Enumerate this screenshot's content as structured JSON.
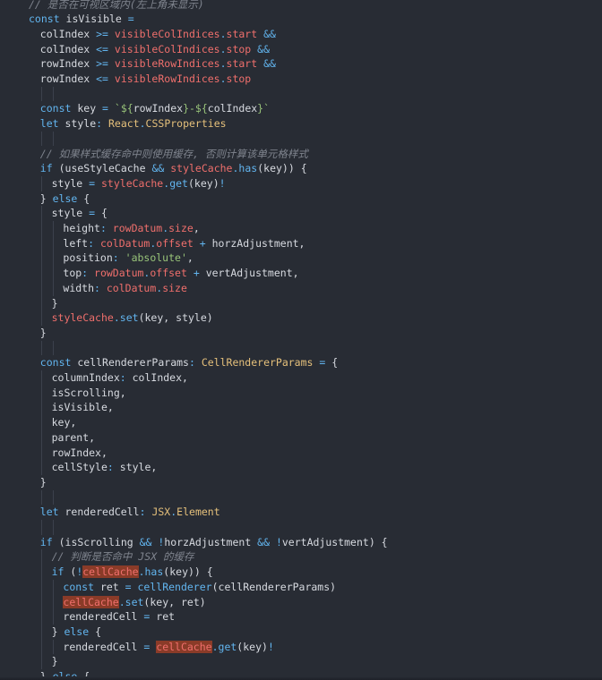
{
  "editor": {
    "lines": [
      {
        "indent": 2,
        "tokens": [
          [
            "cm",
            "// 是否在可视区域内(左上角未显示)"
          ]
        ]
      },
      {
        "indent": 2,
        "tokens": [
          [
            "kw",
            "const "
          ],
          [
            "id",
            "isVisible "
          ],
          [
            "op",
            "="
          ]
        ]
      },
      {
        "indent": 4,
        "tokens": [
          [
            "id",
            "colIndex "
          ],
          [
            "op",
            ">= "
          ],
          [
            "obj",
            "visibleColIndices"
          ],
          [
            "op",
            "."
          ],
          [
            "obj",
            "start "
          ],
          [
            "op",
            "&&"
          ]
        ]
      },
      {
        "indent": 4,
        "tokens": [
          [
            "id",
            "colIndex "
          ],
          [
            "op",
            "<= "
          ],
          [
            "obj",
            "visibleColIndices"
          ],
          [
            "op",
            "."
          ],
          [
            "obj",
            "stop "
          ],
          [
            "op",
            "&&"
          ]
        ]
      },
      {
        "indent": 4,
        "tokens": [
          [
            "id",
            "rowIndex "
          ],
          [
            "op",
            ">= "
          ],
          [
            "obj",
            "visibleRowIndices"
          ],
          [
            "op",
            "."
          ],
          [
            "obj",
            "start "
          ],
          [
            "op",
            "&&"
          ]
        ]
      },
      {
        "indent": 4,
        "tokens": [
          [
            "id",
            "rowIndex "
          ],
          [
            "op",
            "<= "
          ],
          [
            "obj",
            "visibleRowIndices"
          ],
          [
            "op",
            "."
          ],
          [
            "obj",
            "stop"
          ]
        ]
      },
      {
        "indent": 0,
        "tokens": []
      },
      {
        "indent": 4,
        "tokens": [
          [
            "kw",
            "const "
          ],
          [
            "id",
            "key "
          ],
          [
            "op",
            "= "
          ],
          [
            "str",
            "`${"
          ],
          [
            "id",
            "rowIndex"
          ],
          [
            "str",
            "}-${"
          ],
          [
            "id",
            "colIndex"
          ],
          [
            "str",
            "}`"
          ]
        ]
      },
      {
        "indent": 4,
        "tokens": [
          [
            "kw",
            "let "
          ],
          [
            "id",
            "style"
          ],
          [
            "op",
            ": "
          ],
          [
            "type",
            "React"
          ],
          [
            "op",
            "."
          ],
          [
            "type",
            "CSSProperties"
          ]
        ]
      },
      {
        "indent": 0,
        "tokens": []
      },
      {
        "indent": 4,
        "tokens": [
          [
            "cm",
            "// 如果样式缓存命中则使用缓存, 否则计算该单元格样式"
          ]
        ]
      },
      {
        "indent": 4,
        "tokens": [
          [
            "kw",
            "if "
          ],
          [
            "pn",
            "("
          ],
          [
            "id",
            "useStyleCache "
          ],
          [
            "op",
            "&& "
          ],
          [
            "obj",
            "styleCache"
          ],
          [
            "op",
            "."
          ],
          [
            "fn",
            "has"
          ],
          [
            "pn",
            "("
          ],
          [
            "id",
            "key"
          ],
          [
            "pn",
            ")) {"
          ]
        ]
      },
      {
        "indent": 6,
        "tokens": [
          [
            "id",
            "style "
          ],
          [
            "op",
            "= "
          ],
          [
            "obj",
            "styleCache"
          ],
          [
            "op",
            "."
          ],
          [
            "fn",
            "get"
          ],
          [
            "pn",
            "("
          ],
          [
            "id",
            "key"
          ],
          [
            "pn",
            ")"
          ],
          [
            "op",
            "!"
          ]
        ]
      },
      {
        "indent": 4,
        "tokens": [
          [
            "pn",
            "} "
          ],
          [
            "kw",
            "else "
          ],
          [
            "pn",
            "{"
          ]
        ]
      },
      {
        "indent": 6,
        "tokens": [
          [
            "id",
            "style "
          ],
          [
            "op",
            "= "
          ],
          [
            "pn",
            "{"
          ]
        ]
      },
      {
        "indent": 8,
        "tokens": [
          [
            "id",
            "height"
          ],
          [
            "op",
            ": "
          ],
          [
            "obj",
            "rowDatum"
          ],
          [
            "op",
            "."
          ],
          [
            "obj",
            "size"
          ],
          [
            "pn",
            ","
          ]
        ]
      },
      {
        "indent": 8,
        "tokens": [
          [
            "id",
            "left"
          ],
          [
            "op",
            ": "
          ],
          [
            "obj",
            "colDatum"
          ],
          [
            "op",
            "."
          ],
          [
            "obj",
            "offset "
          ],
          [
            "op",
            "+ "
          ],
          [
            "id",
            "horzAdjustment"
          ],
          [
            "pn",
            ","
          ]
        ]
      },
      {
        "indent": 8,
        "tokens": [
          [
            "id",
            "position"
          ],
          [
            "op",
            ": "
          ],
          [
            "str",
            "'absolute'"
          ],
          [
            "pn",
            ","
          ]
        ]
      },
      {
        "indent": 8,
        "tokens": [
          [
            "id",
            "top"
          ],
          [
            "op",
            ": "
          ],
          [
            "obj",
            "rowDatum"
          ],
          [
            "op",
            "."
          ],
          [
            "obj",
            "offset "
          ],
          [
            "op",
            "+ "
          ],
          [
            "id",
            "vertAdjustment"
          ],
          [
            "pn",
            ","
          ]
        ]
      },
      {
        "indent": 8,
        "tokens": [
          [
            "id",
            "width"
          ],
          [
            "op",
            ": "
          ],
          [
            "obj",
            "colDatum"
          ],
          [
            "op",
            "."
          ],
          [
            "obj",
            "size"
          ]
        ]
      },
      {
        "indent": 6,
        "tokens": [
          [
            "pn",
            "}"
          ]
        ]
      },
      {
        "indent": 6,
        "tokens": [
          [
            "obj",
            "styleCache"
          ],
          [
            "op",
            "."
          ],
          [
            "fn",
            "set"
          ],
          [
            "pn",
            "("
          ],
          [
            "id",
            "key"
          ],
          [
            "pn",
            ", "
          ],
          [
            "id",
            "style"
          ],
          [
            "pn",
            ")"
          ]
        ]
      },
      {
        "indent": 4,
        "tokens": [
          [
            "pn",
            "}"
          ]
        ]
      },
      {
        "indent": 0,
        "tokens": []
      },
      {
        "indent": 4,
        "tokens": [
          [
            "kw",
            "const "
          ],
          [
            "id",
            "cellRendererParams"
          ],
          [
            "op",
            ": "
          ],
          [
            "type",
            "CellRendererParams "
          ],
          [
            "op",
            "= "
          ],
          [
            "pn",
            "{"
          ]
        ]
      },
      {
        "indent": 6,
        "tokens": [
          [
            "id",
            "columnIndex"
          ],
          [
            "op",
            ": "
          ],
          [
            "id",
            "colIndex"
          ],
          [
            "pn",
            ","
          ]
        ]
      },
      {
        "indent": 6,
        "tokens": [
          [
            "id",
            "isScrolling"
          ],
          [
            "pn",
            ","
          ]
        ]
      },
      {
        "indent": 6,
        "tokens": [
          [
            "id",
            "isVisible"
          ],
          [
            "pn",
            ","
          ]
        ]
      },
      {
        "indent": 6,
        "tokens": [
          [
            "id",
            "key"
          ],
          [
            "pn",
            ","
          ]
        ]
      },
      {
        "indent": 6,
        "tokens": [
          [
            "id",
            "parent"
          ],
          [
            "pn",
            ","
          ]
        ]
      },
      {
        "indent": 6,
        "tokens": [
          [
            "id",
            "rowIndex"
          ],
          [
            "pn",
            ","
          ]
        ]
      },
      {
        "indent": 6,
        "tokens": [
          [
            "id",
            "cellStyle"
          ],
          [
            "op",
            ": "
          ],
          [
            "id",
            "style"
          ],
          [
            "pn",
            ","
          ]
        ]
      },
      {
        "indent": 4,
        "tokens": [
          [
            "pn",
            "}"
          ]
        ]
      },
      {
        "indent": 0,
        "tokens": []
      },
      {
        "indent": 4,
        "tokens": [
          [
            "kw",
            "let "
          ],
          [
            "id",
            "renderedCell"
          ],
          [
            "op",
            ": "
          ],
          [
            "type",
            "JSX"
          ],
          [
            "op",
            "."
          ],
          [
            "type",
            "Element"
          ]
        ]
      },
      {
        "indent": 0,
        "tokens": []
      },
      {
        "indent": 4,
        "tokens": [
          [
            "kw",
            "if "
          ],
          [
            "pn",
            "("
          ],
          [
            "id",
            "isScrolling "
          ],
          [
            "op",
            "&& !"
          ],
          [
            "id",
            "horzAdjustment "
          ],
          [
            "op",
            "&& !"
          ],
          [
            "id",
            "vertAdjustment"
          ],
          [
            "pn",
            ") {"
          ]
        ]
      },
      {
        "indent": 6,
        "tokens": [
          [
            "cm",
            "// 判断是否命中 JSX 的缓存"
          ]
        ]
      },
      {
        "indent": 6,
        "tokens": [
          [
            "kw",
            "if "
          ],
          [
            "pn",
            "("
          ],
          [
            "op",
            "!"
          ],
          [
            "hl",
            "cellCache"
          ],
          [
            "op",
            "."
          ],
          [
            "fn",
            "has"
          ],
          [
            "pn",
            "("
          ],
          [
            "id",
            "key"
          ],
          [
            "pn",
            ")) {"
          ]
        ]
      },
      {
        "indent": 8,
        "tokens": [
          [
            "kw",
            "const "
          ],
          [
            "id",
            "ret "
          ],
          [
            "op",
            "= "
          ],
          [
            "fn",
            "cellRenderer"
          ],
          [
            "pn",
            "("
          ],
          [
            "id",
            "cellRendererParams"
          ],
          [
            "pn",
            ")"
          ]
        ]
      },
      {
        "indent": 8,
        "tokens": [
          [
            "hl",
            "cellCache"
          ],
          [
            "op",
            "."
          ],
          [
            "fn",
            "set"
          ],
          [
            "pn",
            "("
          ],
          [
            "id",
            "key"
          ],
          [
            "pn",
            ", "
          ],
          [
            "id",
            "ret"
          ],
          [
            "pn",
            ")"
          ]
        ]
      },
      {
        "indent": 8,
        "tokens": [
          [
            "id",
            "renderedCell "
          ],
          [
            "op",
            "= "
          ],
          [
            "id",
            "ret"
          ]
        ]
      },
      {
        "indent": 6,
        "tokens": [
          [
            "pn",
            "} "
          ],
          [
            "kw",
            "else "
          ],
          [
            "pn",
            "{"
          ]
        ]
      },
      {
        "indent": 8,
        "tokens": [
          [
            "id",
            "renderedCell "
          ],
          [
            "op",
            "= "
          ],
          [
            "hl",
            "cellCache"
          ],
          [
            "op",
            "."
          ],
          [
            "fn",
            "get"
          ],
          [
            "pn",
            "("
          ],
          [
            "id",
            "key"
          ],
          [
            "pn",
            ")"
          ],
          [
            "op",
            "!"
          ]
        ]
      },
      {
        "indent": 6,
        "tokens": [
          [
            "pn",
            "}"
          ]
        ]
      },
      {
        "indent": 4,
        "tokens": [
          [
            "pn",
            "} "
          ],
          [
            "kw",
            "else "
          ],
          [
            "pn",
            "{"
          ]
        ]
      }
    ]
  }
}
